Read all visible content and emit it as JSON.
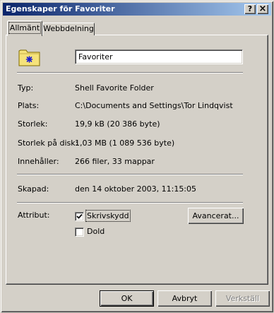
{
  "window": {
    "title": "Egenskaper för Favoriter",
    "help_button": "?",
    "close_button": "×"
  },
  "tabs": [
    {
      "label": "Allmänt",
      "active": true
    },
    {
      "label": "Webbdelning",
      "active": false
    }
  ],
  "general": {
    "folder_icon": "folder-favorites-icon",
    "name_value": "Favoriter",
    "fields": [
      {
        "label": "Typ:",
        "value": "Shell Favorite Folder"
      },
      {
        "label": "Plats:",
        "value": "C:\\Documents and Settings\\Tor Lindqvist"
      },
      {
        "label": "Storlek:",
        "value": "19,9 kB (20 386 byte)"
      },
      {
        "label": "Storlek på disk:",
        "value": "1,03 MB (1 089 536 byte)"
      },
      {
        "label": "Innehåller:",
        "value": "266 filer, 33 mappar"
      }
    ],
    "created": {
      "label": "Skapad:",
      "value": "den 14 oktober 2003, 11:15:05"
    },
    "attributes": {
      "label": "Attribut:",
      "read_only": {
        "label": "Skrivskydd",
        "checked": true
      },
      "hidden": {
        "label": "Dold",
        "checked": false
      },
      "advanced_button": "Avancerat..."
    }
  },
  "footer": {
    "ok": "OK",
    "cancel": "Avbryt",
    "apply": "Verkställ"
  }
}
